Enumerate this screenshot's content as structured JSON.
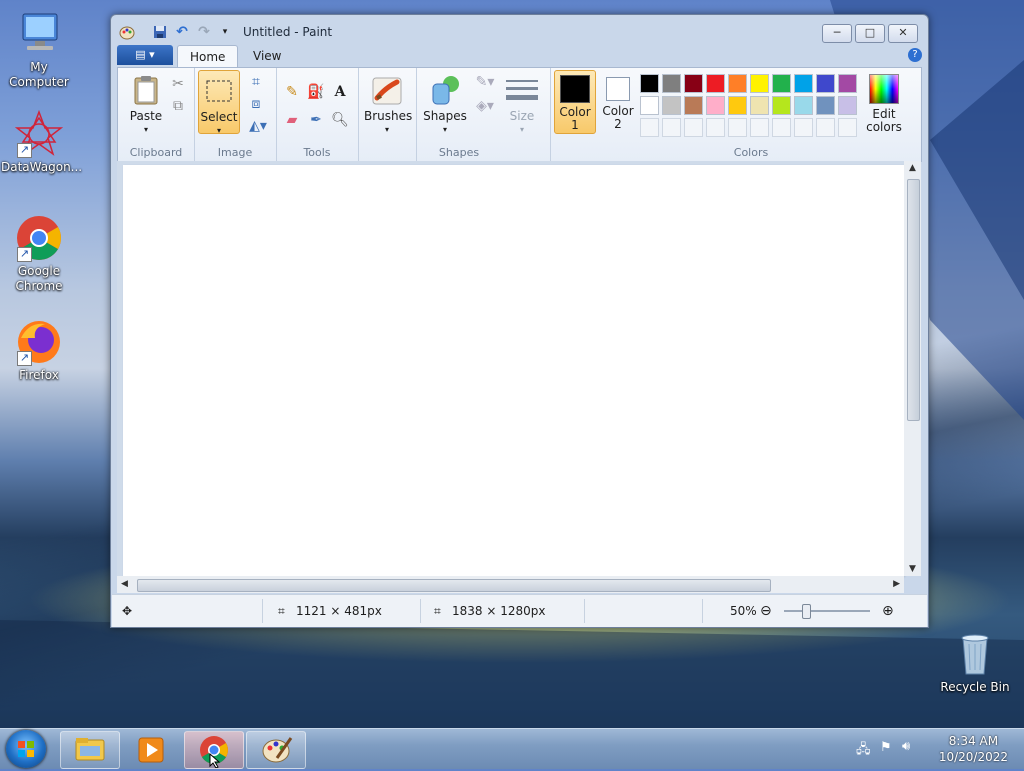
{
  "desktop": {
    "icons": [
      {
        "label": "My Computer"
      },
      {
        "label": "DataWagon..."
      },
      {
        "label": "Google Chrome"
      },
      {
        "label": "Firefox"
      },
      {
        "label": "Recycle Bin"
      }
    ]
  },
  "window": {
    "title": "Untitled - Paint",
    "minimize": "─",
    "maximize": "□",
    "close": "✕"
  },
  "ribbon": {
    "tabs": {
      "home": "Home",
      "view": "View"
    },
    "groups": {
      "clipboard": "Clipboard",
      "image": "Image",
      "tools": "Tools",
      "shapes": "Shapes",
      "colors": "Colors"
    },
    "buttons": {
      "paste": "Paste",
      "select": "Select",
      "brushes": "Brushes",
      "shapes": "Shapes",
      "size": "Size",
      "color1_line1": "Color",
      "color1_line2": "1",
      "color2_line1": "Color",
      "color2_line2": "2",
      "edit_colors_line1": "Edit",
      "edit_colors_line2": "colors"
    },
    "palette_row1": [
      "#000000",
      "#7f7f7f",
      "#880015",
      "#ed1c24",
      "#ff7f27",
      "#fff200",
      "#22b14c",
      "#00a2e8",
      "#3f48cc",
      "#a349a4"
    ],
    "palette_row2": [
      "#ffffff",
      "#c3c3c3",
      "#b97a57",
      "#ffaec9",
      "#ffc90e",
      "#efe4b0",
      "#b5e61d",
      "#99d9ea",
      "#7092be",
      "#c8bfe7"
    ],
    "color1": "#000000",
    "color2": "#ffffff"
  },
  "status": {
    "selection_size": "1121 × 481px",
    "image_size": "1838 × 1280px",
    "zoom": "50%"
  },
  "taskbar": {
    "clock_time": "8:34 AM",
    "clock_date": "10/20/2022"
  }
}
